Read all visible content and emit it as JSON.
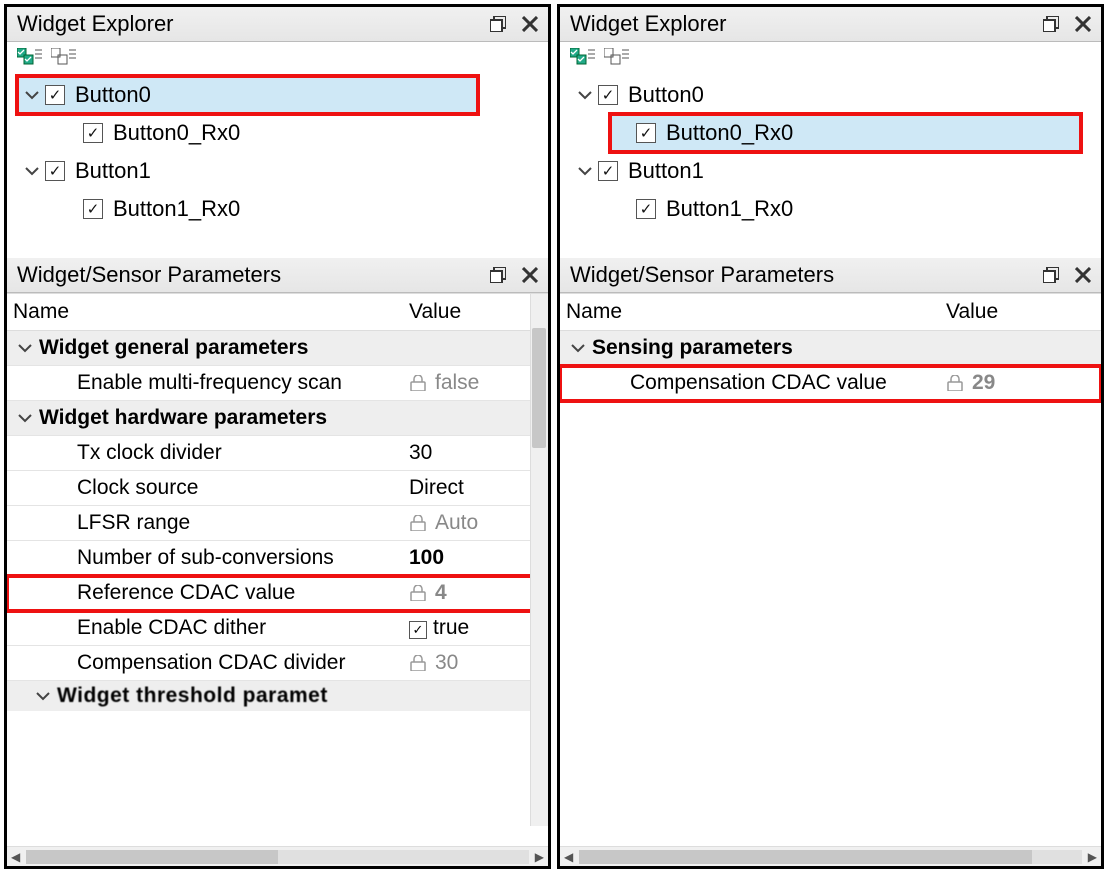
{
  "left": {
    "explorer": {
      "title": "Widget Explorer",
      "items": [
        {
          "label": "Button0",
          "children": [
            {
              "label": "Button0_Rx0"
            }
          ]
        },
        {
          "label": "Button1",
          "children": [
            {
              "label": "Button1_Rx0"
            }
          ]
        }
      ],
      "selected": "Button0",
      "highlight": "Button0"
    },
    "params": {
      "title": "Widget/Sensor Parameters",
      "headers": {
        "name": "Name",
        "value": "Value"
      },
      "sections": [
        {
          "title": "Widget general parameters",
          "rows": [
            {
              "name": "Enable multi-frequency scan",
              "value": "false",
              "locked": true
            }
          ]
        },
        {
          "title": "Widget hardware parameters",
          "rows": [
            {
              "name": "Tx clock divider",
              "value": "30"
            },
            {
              "name": "Clock source",
              "value": "Direct"
            },
            {
              "name": "LFSR range",
              "value": "Auto",
              "locked": true
            },
            {
              "name": "Number of sub-conversions",
              "value": "100",
              "bold": true
            },
            {
              "name": "Reference CDAC value",
              "value": "4",
              "locked": true,
              "highlight": true
            },
            {
              "name": "Enable CDAC dither",
              "value": "true",
              "check": true
            },
            {
              "name": "Compensation CDAC divider",
              "value": "30",
              "locked": true
            }
          ]
        }
      ],
      "cutoff_section_hint": "Widget threshold parameters"
    }
  },
  "right": {
    "explorer": {
      "title": "Widget Explorer",
      "items": [
        {
          "label": "Button0",
          "children": [
            {
              "label": "Button0_Rx0"
            }
          ]
        },
        {
          "label": "Button1",
          "children": [
            {
              "label": "Button1_Rx0"
            }
          ]
        }
      ],
      "selected": "Button0_Rx0",
      "highlight": "Button0_Rx0"
    },
    "params": {
      "title": "Widget/Sensor Parameters",
      "headers": {
        "name": "Name",
        "value": "Value"
      },
      "sections": [
        {
          "title": "Sensing parameters",
          "rows": [
            {
              "name": "Compensation CDAC value",
              "value": "29",
              "locked": true,
              "highlight": true
            }
          ]
        }
      ]
    }
  }
}
